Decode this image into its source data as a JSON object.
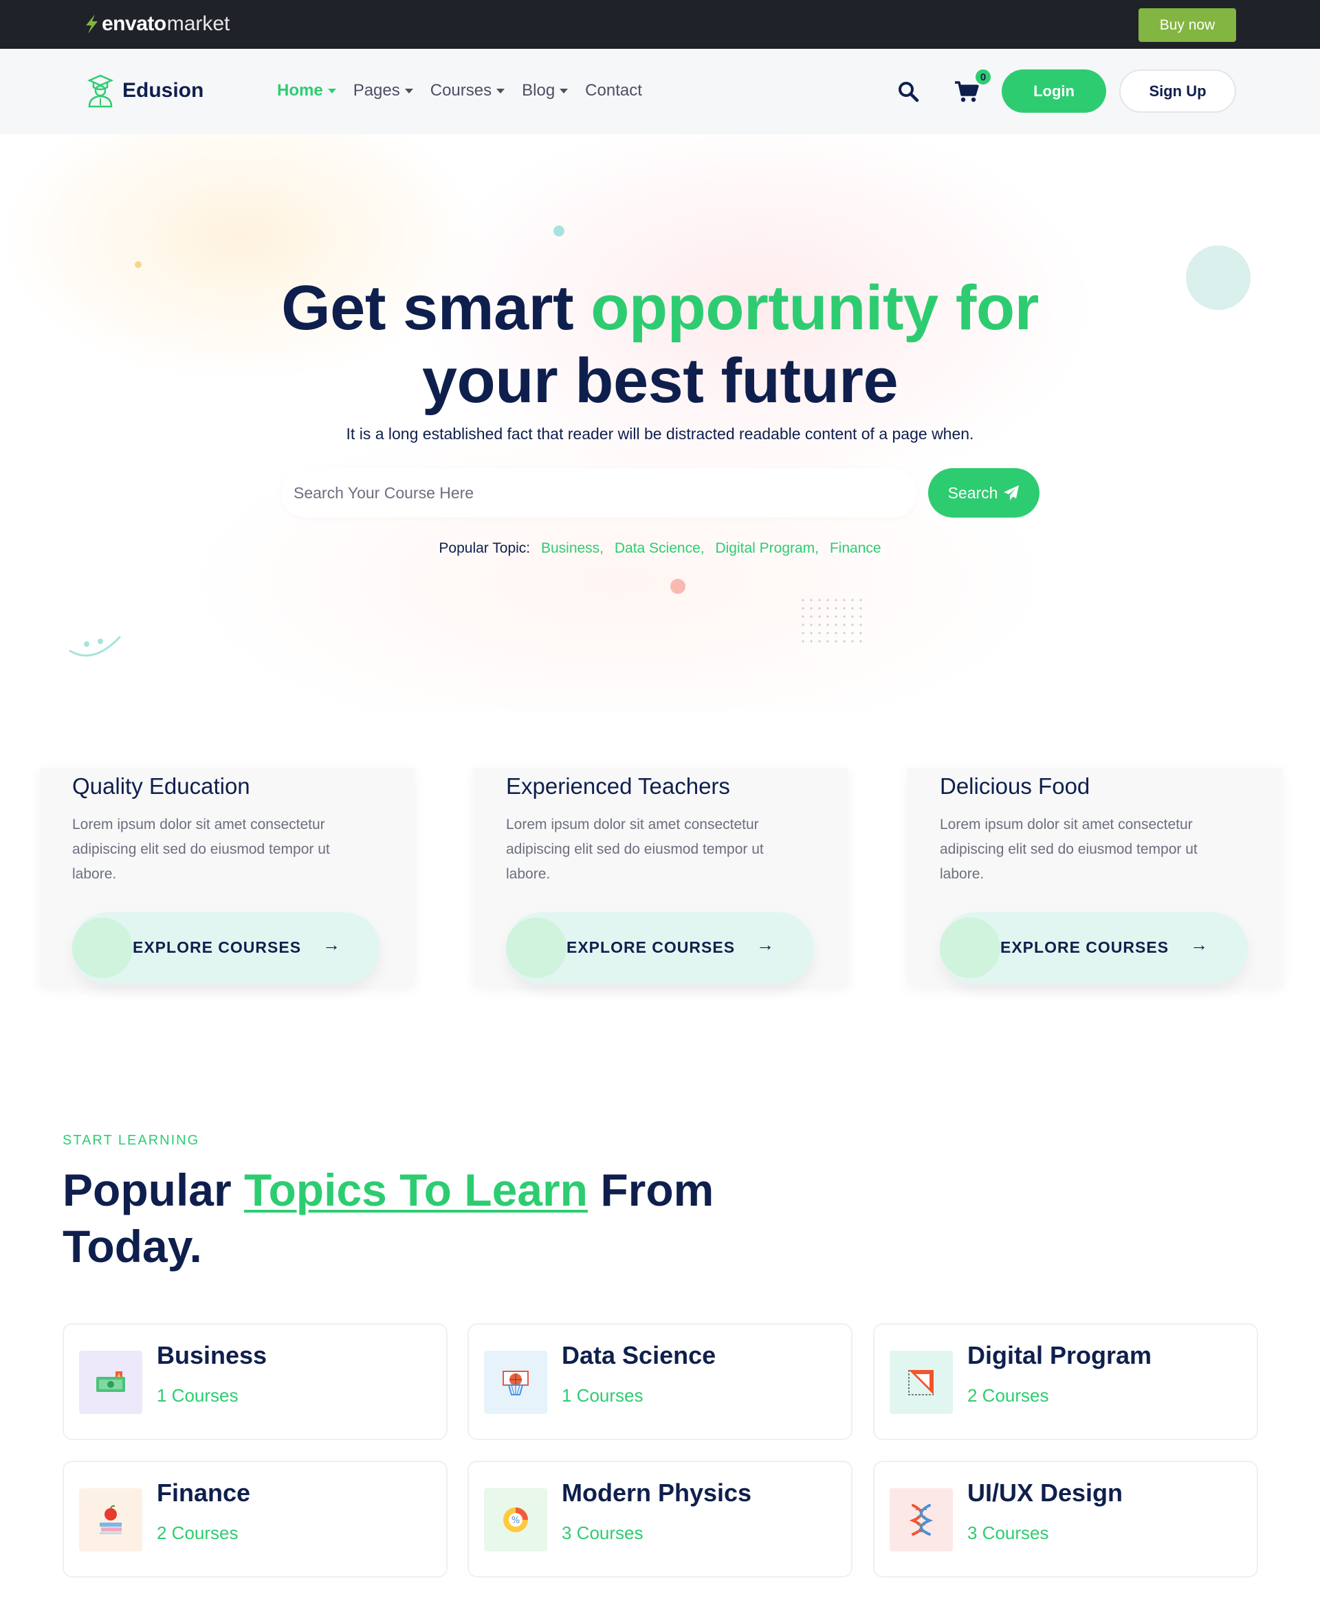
{
  "envato": {
    "brand": "envato",
    "market": "market",
    "buy_now": "Buy now"
  },
  "nav": {
    "site_name": "Edusion",
    "items": [
      {
        "label": "Home",
        "active": true,
        "dropdown": true
      },
      {
        "label": "Pages",
        "active": false,
        "dropdown": true
      },
      {
        "label": "Courses",
        "active": false,
        "dropdown": true
      },
      {
        "label": "Blog",
        "active": false,
        "dropdown": true
      },
      {
        "label": "Contact",
        "active": false,
        "dropdown": false
      }
    ],
    "cart_count": "0",
    "login": "Login",
    "signup": "Sign Up"
  },
  "hero": {
    "title_part1": "Get smart ",
    "title_accent": "opportunity for",
    "title_part2": "your best future",
    "subtitle": "It is a long established fact that reader will be distracted readable content of a page when.",
    "search_placeholder": "Search Your Course Here",
    "search_button": "Search",
    "popular_label": "Popular Topic:",
    "popular_topics": [
      "Business,",
      "Data Science,",
      "Digital Program,",
      "Finance"
    ]
  },
  "features": [
    {
      "title": "Quality Education",
      "text": "Lorem ipsum dolor sit amet consectetur adipiscing elit sed do eiusmod tempor ut labore.",
      "button": "EXPLORE COURSES",
      "arrow": "→"
    },
    {
      "title": "Experienced Teachers",
      "text": "Lorem ipsum dolor sit amet consectetur adipiscing elit sed do eiusmod tempor ut labore.",
      "button": "EXPLORE COURSES",
      "arrow": "→"
    },
    {
      "title": "Delicious Food",
      "text": "Lorem ipsum dolor sit amet consectetur adipiscing elit sed do eiusmod tempor ut labore.",
      "button": "EXPLORE COURSES",
      "arrow": "→"
    }
  ],
  "topics_section": {
    "tag": "START LEARNING",
    "title_part1": "Popular ",
    "title_accent": "Topics To Learn",
    "title_part2": " From Today."
  },
  "topics": [
    {
      "name": "Business",
      "count": "1 Courses",
      "icon": "money-icon",
      "bg": "#ede9fb"
    },
    {
      "name": "Data Science",
      "count": "1 Courses",
      "icon": "basketball-hoop-icon",
      "bg": "#e6f3fb"
    },
    {
      "name": "Digital Program",
      "count": "2 Courses",
      "icon": "set-square-icon",
      "bg": "#e2f6f1"
    },
    {
      "name": "Finance",
      "count": "2 Courses",
      "icon": "apple-books-icon",
      "bg": "#fdf1e6"
    },
    {
      "name": "Modern Physics",
      "count": "3 Courses",
      "icon": "percent-chart-icon",
      "bg": "#e8f8ea"
    },
    {
      "name": "UI/UX Design",
      "count": "3 Courses",
      "icon": "dna-icon",
      "bg": "#fde8e8"
    }
  ],
  "colors": {
    "accent": "#2ecc71",
    "navy": "#0f1f4d",
    "envato_green": "#82b541",
    "envato_bar": "#1f2228"
  }
}
